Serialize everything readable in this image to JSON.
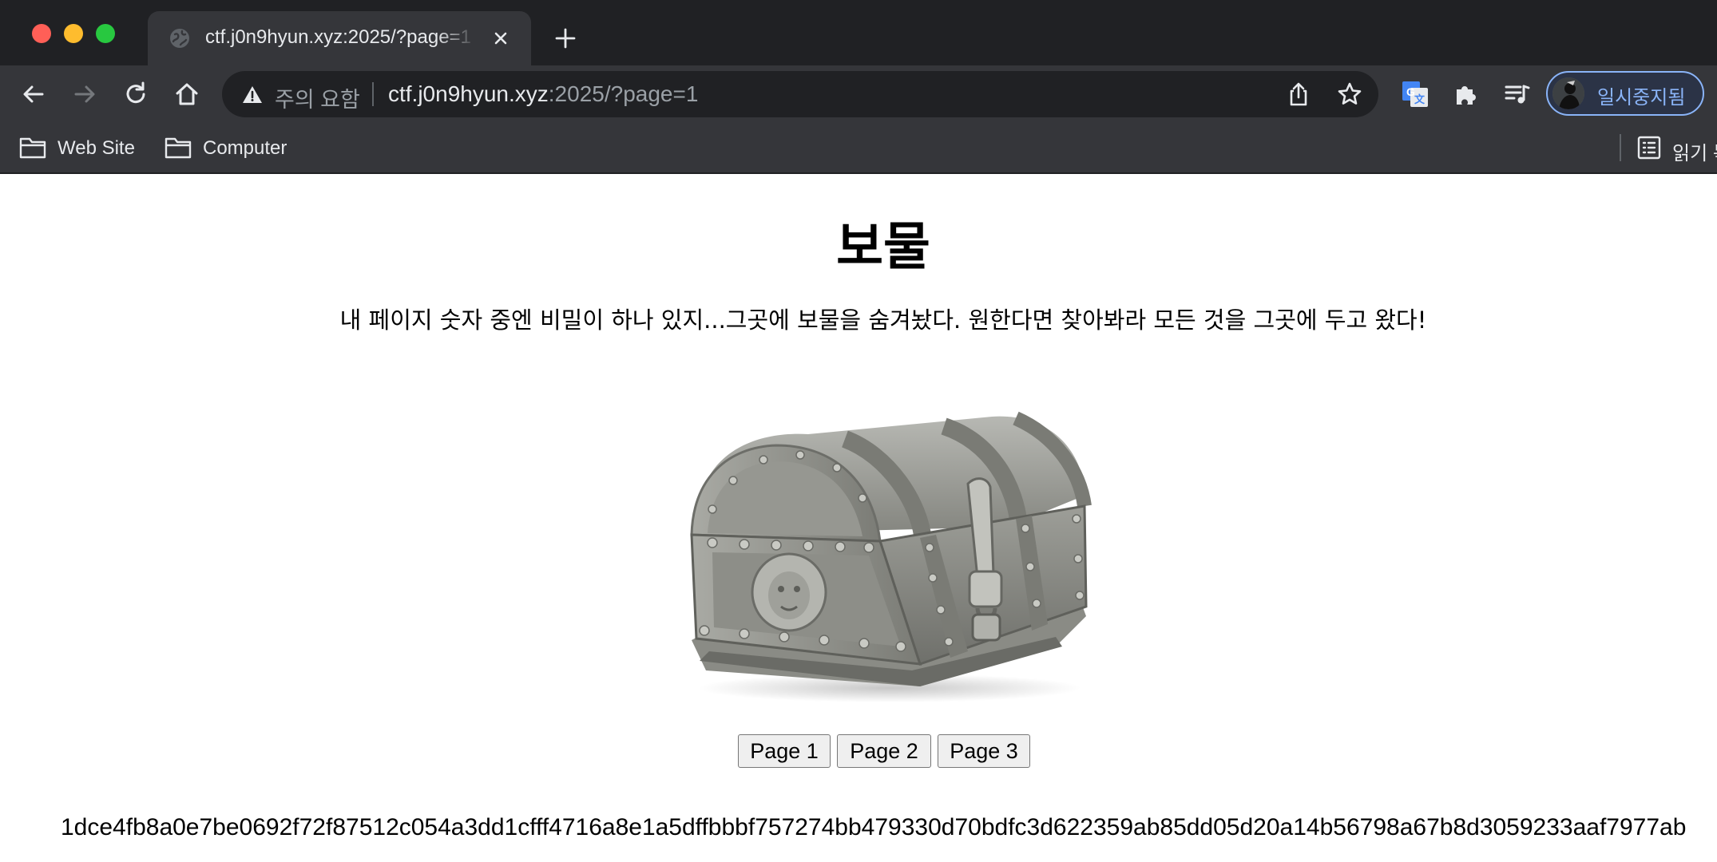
{
  "browser": {
    "tab": {
      "title": "ctf.j0n9hyun.xyz:2025/?page=1"
    },
    "address_bar": {
      "security_label": "주의 요함",
      "host": "ctf.j0n9hyun.xyz",
      "path": ":2025/?page=1"
    },
    "profile": {
      "label": "일시중지됨"
    },
    "bookmarks": [
      {
        "label": "Web Site",
        "icon": "folder-icon"
      },
      {
        "label": "Computer",
        "icon": "folder-icon"
      }
    ],
    "reading_list": {
      "label": "읽기 목록",
      "icon": "reading-list-icon"
    },
    "colors": {
      "titlebar": "#202124",
      "toolbar": "#35363a",
      "accent": "#8ab4f8"
    }
  },
  "page": {
    "title": "보물",
    "description": "내 페이지 숫자 중엔 비밀이 하나 있지...그곳에 보물을 숨겨놨다. 원한다면 찾아봐라 모든 것을 그곳에 두고 왔다!",
    "image": "treasure-chest",
    "buttons": [
      {
        "label": "Page 1"
      },
      {
        "label": "Page 2"
      },
      {
        "label": "Page 3"
      }
    ],
    "hash": "1dce4fb8a0e7be0692f72f87512c054a3dd1cfff4716a8e1a5dffbbbf757274bb479330d70bdfc3d622359ab85dd05d20a14b56798a67b8d3059233aaf7977ab"
  }
}
